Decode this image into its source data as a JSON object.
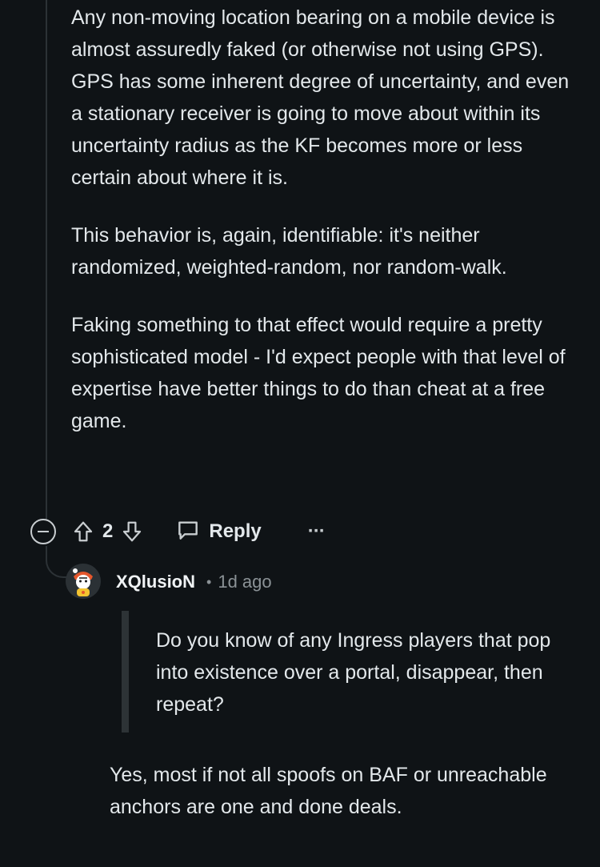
{
  "comment": {
    "paragraphs": [
      "Any non-moving location bearing on a mobile device is almost assuredly faked (or otherwise not using GPS). GPS has some inherent degree of uncertainty, and even a stationary receiver is going to move about within its uncertainty radius as the KF becomes more or less certain about where it is.",
      "This behavior is, again, identifiable: it's neither randomized, weighted-random, nor random-walk.",
      "Faking something to that effect would require a pretty sophisticated model - I'd expect people with that level of expertise have better things to do than cheat at a free game."
    ],
    "vote_count": "2",
    "reply_label": "Reply",
    "more_label": "···"
  },
  "reply": {
    "username": "XQlusioN",
    "separator": "•",
    "time": "1d ago",
    "quote": "Do you know of any Ingress players that pop into existence over a portal, disappear, then repeat?",
    "text": "Yes, most if not all spoofs on BAF or unreachable anchors are one and done deals."
  },
  "icons": {
    "collapse": "collapse-minus-icon",
    "upvote": "upvote-arrow-icon",
    "downvote": "downvote-arrow-icon",
    "reply": "speech-bubble-icon",
    "more": "more-options-icon",
    "avatar": "user-avatar"
  },
  "colors": {
    "background": "#0f1316",
    "text": "#e3e8eb",
    "muted": "#8b9296",
    "thread_line": "#2c3236"
  }
}
